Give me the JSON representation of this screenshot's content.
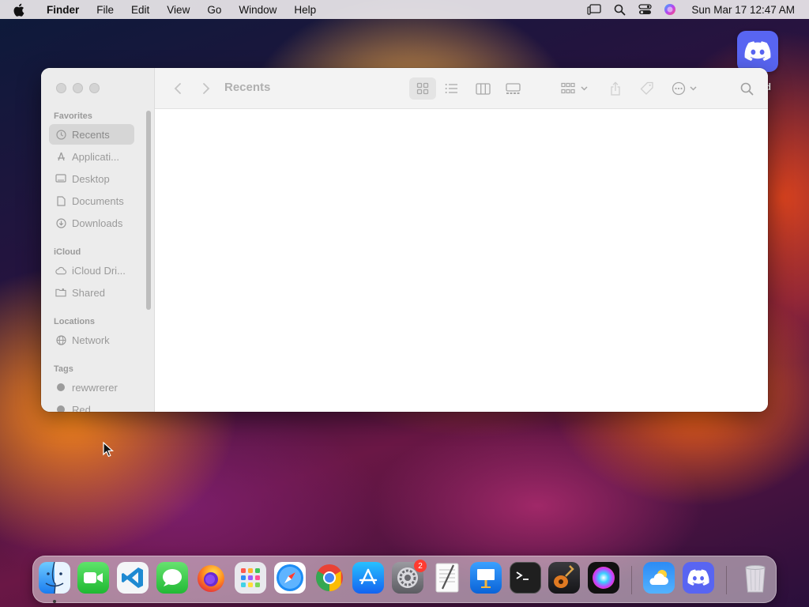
{
  "menubar": {
    "app_name": "Finder",
    "items": [
      "File",
      "Edit",
      "View",
      "Go",
      "Window",
      "Help"
    ],
    "clock": "Sun Mar 17  12:47 AM",
    "status_icons": [
      "stage-manager-icon",
      "spotlight-icon",
      "control-center-icon",
      "siri-icon"
    ]
  },
  "desktop": {
    "items": [
      {
        "label": "rd",
        "icon": "discord-icon"
      }
    ]
  },
  "finder": {
    "title": "Recents",
    "sidebar": {
      "sections": [
        {
          "title": "Favorites",
          "items": [
            {
              "label": "Recents",
              "icon": "clock-icon",
              "selected": true
            },
            {
              "label": "Applicati...",
              "icon": "applications-icon"
            },
            {
              "label": "Desktop",
              "icon": "desktop-icon"
            },
            {
              "label": "Documents",
              "icon": "document-icon"
            },
            {
              "label": "Downloads",
              "icon": "download-icon"
            }
          ]
        },
        {
          "title": "iCloud",
          "items": [
            {
              "label": "iCloud Dri...",
              "icon": "cloud-icon"
            },
            {
              "label": "Shared",
              "icon": "shared-folder-icon"
            }
          ]
        },
        {
          "title": "Locations",
          "items": [
            {
              "label": "Network",
              "icon": "network-icon"
            }
          ]
        },
        {
          "title": "Tags",
          "items": [
            {
              "label": "rewwrerer",
              "icon": "tag-dot-icon"
            },
            {
              "label": "Red",
              "icon": "tag-dot-icon"
            }
          ]
        }
      ]
    },
    "toolbar": {
      "buttons": [
        "back-icon",
        "forward-icon",
        "icon-view-icon",
        "list-view-icon",
        "column-view-icon",
        "gallery-view-icon",
        "group-icon",
        "share-icon",
        "tag-icon",
        "more-icon",
        "search-icon"
      ]
    }
  },
  "dock": {
    "apps": [
      {
        "name": "Finder",
        "running": true
      },
      {
        "name": "FaceTime"
      },
      {
        "name": "Visual Studio Code"
      },
      {
        "name": "Messages"
      },
      {
        "name": "Firefox"
      },
      {
        "name": "Launchpad"
      },
      {
        "name": "Safari"
      },
      {
        "name": "Chrome"
      },
      {
        "name": "App Store"
      },
      {
        "name": "System Settings",
        "badge": "2"
      },
      {
        "name": "TextEdit"
      },
      {
        "name": "Keynote"
      },
      {
        "name": "Terminal"
      },
      {
        "name": "GarageBand"
      },
      {
        "name": "Siri"
      },
      {
        "name": "Weather"
      },
      {
        "name": "Discord"
      },
      {
        "name": "Trash"
      }
    ]
  }
}
